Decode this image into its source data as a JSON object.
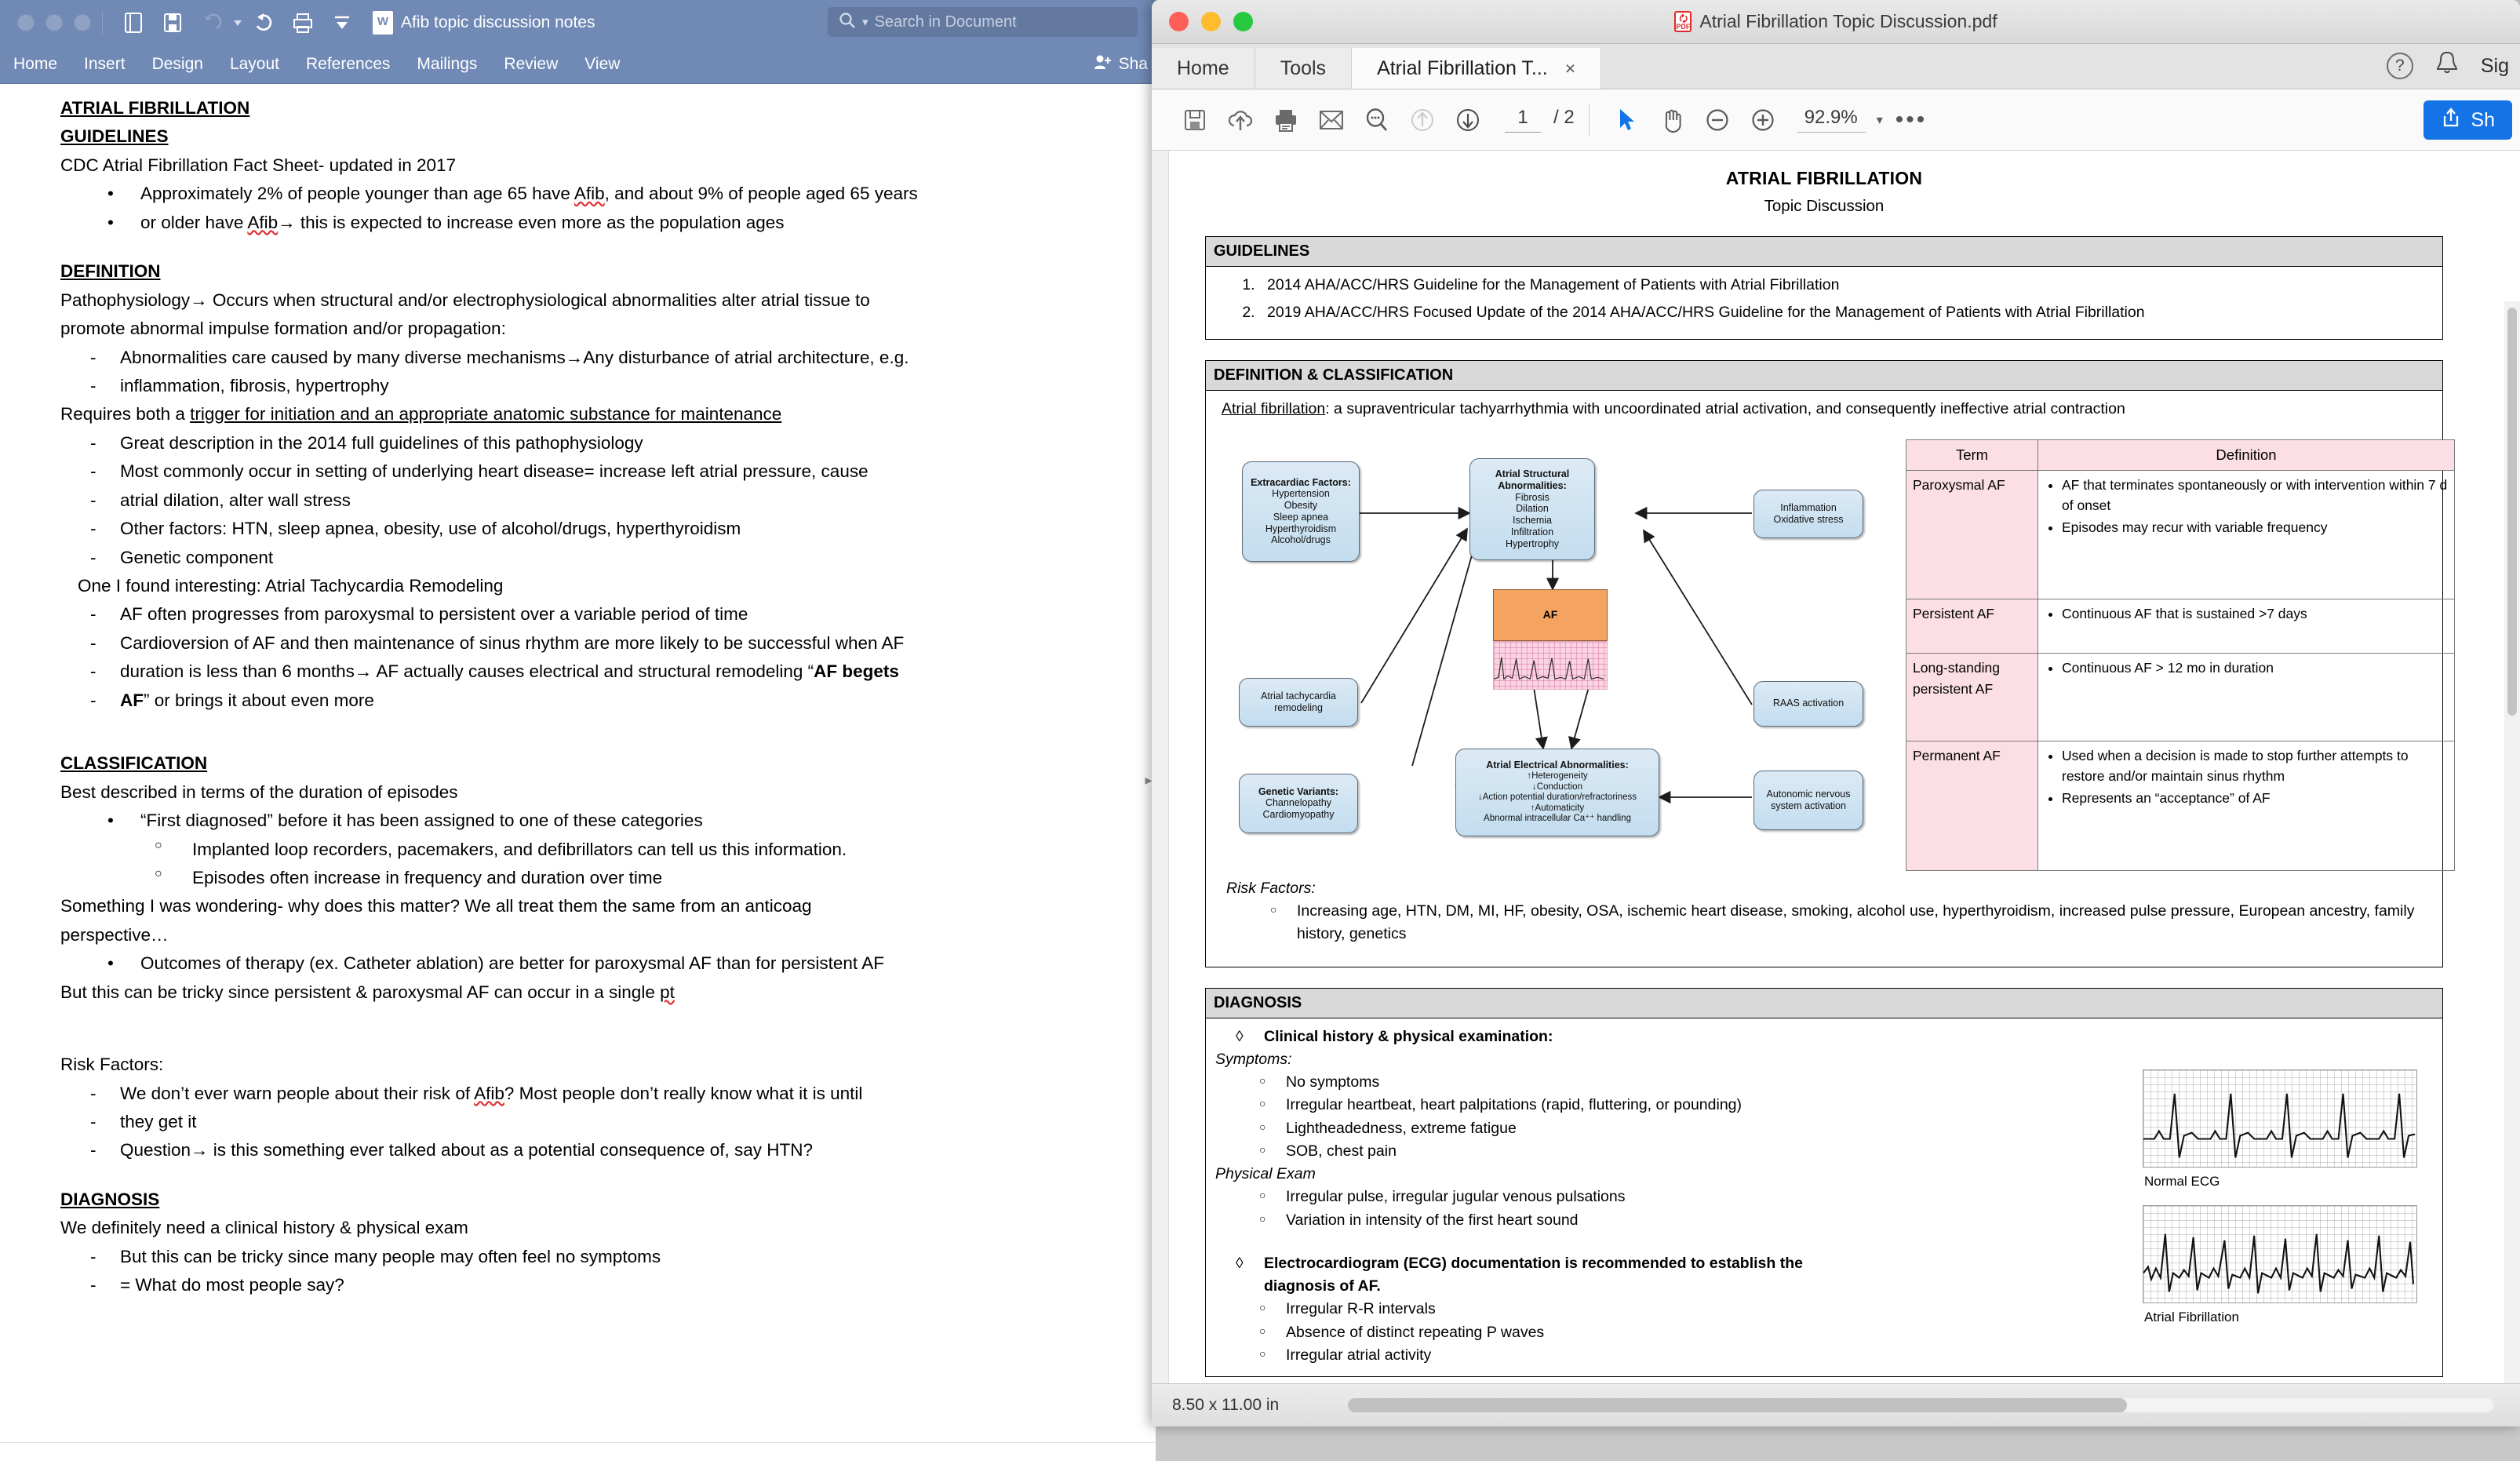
{
  "word": {
    "doc_title": "Afib topic discussion notes",
    "search_placeholder": "Search in Document",
    "share_label": "Sha",
    "ribbon_tabs": [
      "Home",
      "Insert",
      "Design",
      "Layout",
      "References",
      "Mailings",
      "Review",
      "View"
    ],
    "toolbar_icons": [
      "document-icon",
      "save-icon",
      "undo-icon",
      "redo-icon",
      "print-icon",
      "customize-icon"
    ],
    "body": {
      "h_atrial_fibrillation": "ATRIAL FIBRILLATION",
      "h_guidelines": "GUIDELINES",
      "cdc_line": "CDC Atrial Fibrillation Fact Sheet- updated in 2017",
      "bullet_stats_a": "Approximately 2% of people younger than age 65 have ",
      "bullet_stats_afib": "Afib",
      "bullet_stats_b": ", and about 9% of people aged 65 years",
      "bullet_stats_line2_a": "or older have ",
      "bullet_stats_line2_afib": "Afib",
      "bullet_stats_line2_b": "→ this is expected to increase even more as the population ages",
      "h_definition": "DEFINITION",
      "patho_line1": "Pathophysiology→ Occurs when structural and/or electrophysiological abnormalities alter atrial tissue to",
      "patho_line2": "promote abnormal impulse formation and/or propagation:",
      "dash_abnorm_1": "Abnormalities care caused by many diverse mechanisms→Any disturbance of atrial architecture, e.g.",
      "dash_abnorm_2": "inflammation, fibrosis, hypertrophy",
      "requires_pre": "Requires both a ",
      "requires_u": "trigger for initiation and an appropriate anatomic substance for maintenance",
      "dash_great": "Great description in the 2014 full guidelines of this pathophysiology",
      "dash_common_1": "Most commonly occur in setting of underlying heart disease= increase left atrial pressure, cause",
      "dash_common_2": "atrial dilation, alter wall stress",
      "dash_other": "Other factors: HTN, sleep apnea, obesity, use of alcohol/drugs, hyperthyroidism",
      "dash_genetic": "Genetic component",
      "one_found": "One I found interesting: Atrial Tachycardia Remodeling",
      "dash_progress": "AF often progresses from paroxysmal to persistent over a variable period of time",
      "dash_cardio_1": "Cardioversion of AF and then maintenance of sinus rhythm are more likely to be successful when AF",
      "dash_cardio_2a": "duration is less than 6 months→ AF actually causes electrical and structural remodeling “",
      "dash_cardio_2b": "AF begets",
      "dash_cardio_3a": "AF",
      "dash_cardio_3b": "” or brings it about even more",
      "h_classification": "CLASSIFICATION",
      "best_described": "Best described in terms of the duration of episodes",
      "bullet_first": "“First diagnosed” before it has been assigned to one of these categories",
      "circ_implanted": "Implanted loop recorders, pacemakers, and defibrillators can tell us this information.",
      "circ_episodes": "Episodes often increase in frequency and duration over time",
      "something_1": "Something I was wondering- why does this matter? We all treat them the same from an anticoag",
      "something_2": "perspective…",
      "bullet_outcomes": "Outcomes of therapy (ex. Catheter ablation) are better for paroxysmal AF than for persistent AF",
      "but_tricky_pre": "But this can be tricky since persistent & paroxysmal AF can occur in a single ",
      "but_tricky_pt": "pt",
      "h_risk_factors": "Risk Factors:",
      "dash_warn_1a": "We don’t ever warn people about their risk of ",
      "dash_warn_afib": "Afib",
      "dash_warn_1b": "? Most people don’t really know what it is until",
      "dash_warn_2": "they get it",
      "dash_question": "Question→ is this something ever talked about as a potential consequence of, say HTN?",
      "h_diagnosis": "DIAGNOSIS",
      "need_clinical": "We definitely need a clinical history & physical exam",
      "dash_tricky_sym": "But this can be tricky since many people may often feel no symptoms",
      "dash_what_do": "= What do most people say?"
    }
  },
  "pdf": {
    "window_title": "Atrial Fibrillation Topic Discussion.pdf",
    "nav_tabs": [
      "Home",
      "Tools"
    ],
    "doc_tab": "Atrial Fibrillation T...",
    "doc_tab_close": "×",
    "help_icon": "?",
    "bell_icon": "🔔",
    "signin_label": "Sig",
    "toolbar": {
      "icons": [
        "save-icon",
        "upload-cloud-icon",
        "print-icon",
        "email-icon",
        "search-icon",
        "previous-page-icon",
        "next-page-icon",
        "select-cursor-icon",
        "hand-tool-icon",
        "zoom-out-icon",
        "zoom-in-icon"
      ],
      "page_current": "1",
      "page_total": "/ 2",
      "zoom_value": "92.9%",
      "more_label": "•••",
      "share_label": "Sh"
    },
    "statusbar": {
      "page_size": "8.50 x 11.00 in"
    },
    "document": {
      "title": "ATRIAL FIBRILLATION",
      "subtitle": "Topic Discussion",
      "guidelines_header": "GUIDELINES",
      "guidelines": [
        "2014 AHA/ACC/HRS Guideline for the Management of Patients with Atrial Fibrillation",
        "2019 AHA/ACC/HRS Focused Update of the 2014 AHA/ACC/HRS Guideline for the Management of Patients with Atrial Fibrillation"
      ],
      "definition_header": "DEFINITION & CLASSIFICATION",
      "definition_term": "Atrial fibrillation",
      "definition_text": ": a supraventricular tachyarrhythmia with uncoordinated atrial activation, and consequently ineffective atrial contraction",
      "diagram": {
        "extracardiac_title": "Extracardiac Factors:",
        "extracardiac_items": [
          "Hypertension",
          "Obesity",
          "Sleep apnea",
          "Hyperthyroidism",
          "Alcohol/drugs"
        ],
        "structural_title": "Atrial Structural Abnormalities:",
        "structural_items": [
          "Fibrosis",
          "Dilation",
          "Ischemia",
          "Infiltration",
          "Hypertrophy"
        ],
        "inflammation": "Inflammation Oxidative stress",
        "tachycardia": "Atrial tachycardia remodeling",
        "raas": "RAAS activation",
        "af_label": "AF",
        "genetic_title": "Genetic Variants:",
        "genetic_items": [
          "Channelopathy",
          "Cardiomyopathy"
        ],
        "electrical_title": "Atrial Electrical Abnormalities:",
        "electrical_items": [
          "↑Heterogeneity",
          "↓Conduction",
          "↓Action potential duration/refractoriness",
          "↑Automaticity",
          "Abnormal intracellular Ca⁺⁺ handling"
        ],
        "autonomic": "Autonomic nervous system activation"
      },
      "table": {
        "headers": [
          "Term",
          "Definition"
        ],
        "rows": [
          {
            "term": "Paroxysmal AF",
            "defs": [
              "AF that terminates spontaneously or with intervention within 7 d of onset",
              "Episodes may recur with variable frequency"
            ]
          },
          {
            "term": "Persistent AF",
            "defs": [
              "Continuous AF that is sustained >7 days"
            ]
          },
          {
            "term": "Long-standing persistent AF",
            "defs": [
              "Continuous AF > 12 mo in duration"
            ]
          },
          {
            "term": "Permanent AF",
            "defs": [
              "Used when a decision is made to stop further attempts to restore and/or maintain sinus rhythm",
              "Represents an “acceptance” of AF"
            ]
          }
        ]
      },
      "risk_factors_label": "Risk Factors:",
      "risk_factors_text": "Increasing age, HTN, DM, MI, HF, obesity, OSA, ischemic heart disease, smoking, alcohol use, hyperthyroidism, increased pulse pressure, European ancestry, family history, genetics",
      "diagnosis_header": "DIAGNOSIS",
      "dx_clinical": "Clinical history & physical examination:",
      "dx_symptoms_label": "Symptoms:",
      "dx_symptoms": [
        "No symptoms",
        "Irregular heartbeat, heart palpitations (rapid, fluttering, or pounding)",
        "Lightheadedness, extreme fatigue",
        "SOB, chest pain"
      ],
      "dx_exam_label": "Physical Exam",
      "dx_exam": [
        "Irregular pulse, irregular jugular venous pulsations",
        "Variation in intensity of the first heart sound"
      ],
      "dx_ecg_line1": "Electrocardiogram (ECG) documentation is recommended to establish the",
      "dx_ecg_line2": "diagnosis of AF.",
      "dx_ecg_items": [
        "Irregular R-R intervals",
        "Absence of distinct repeating P waves",
        "Irregular atrial activity"
      ],
      "ecg_normal_label": "Normal ECG",
      "ecg_af_label": "Atrial Fibrillation"
    }
  },
  "colors": {
    "word_chrome": "#7089b5",
    "pdf_accent": "#1473e6",
    "table_header": "#fbdfe4",
    "section_band": "#d9d9d9",
    "af_box": "#f4a460",
    "node_box": "#c3ddef"
  }
}
